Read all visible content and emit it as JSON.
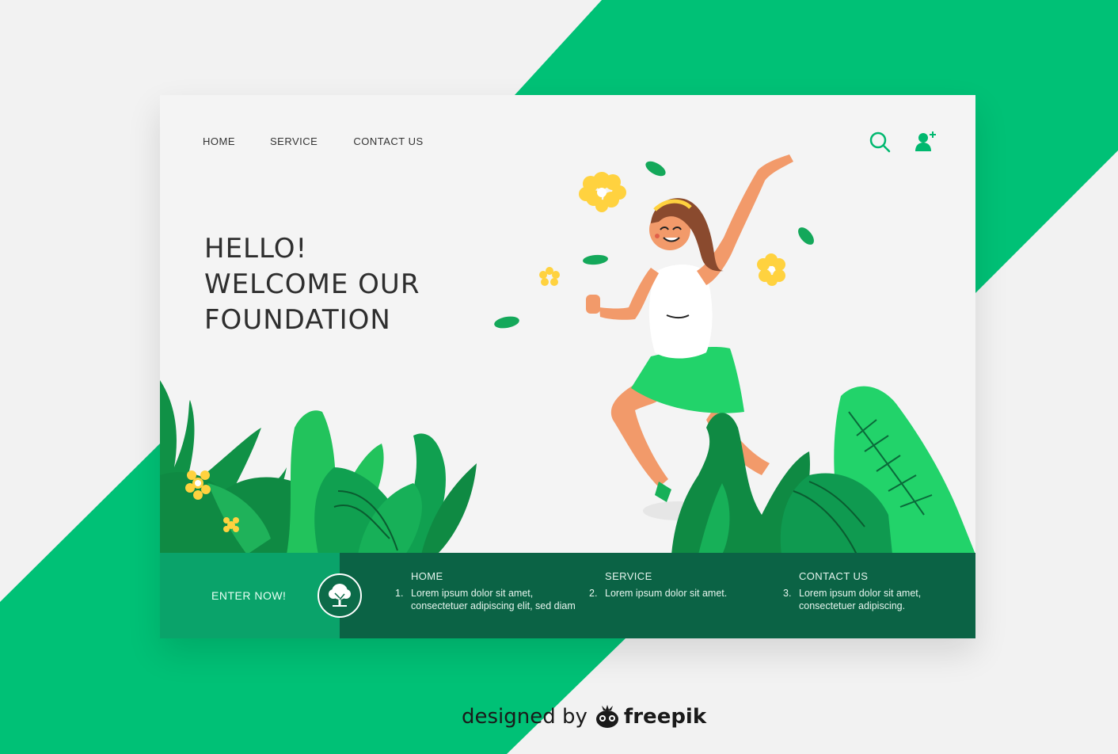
{
  "colors": {
    "accent": "#00c176",
    "dark_green": "#0b6345",
    "mid_green": "#0aa36a",
    "flower": "#ffd23f"
  },
  "nav": {
    "home": "HOME",
    "service": "SERVICE",
    "contact": "CONTACT US"
  },
  "icons": {
    "search": "search-icon",
    "add_user": "add-user-icon"
  },
  "hero": {
    "line1": "HELLO!",
    "line2": "WELCOME OUR",
    "line3": "FOUNDATION"
  },
  "footer": {
    "enter_label": "ENTER NOW!",
    "columns": [
      {
        "title": "HOME",
        "num": "1.",
        "text": "Lorem ipsum dolor sit amet, consectetuer adipiscing elit, sed diam"
      },
      {
        "title": "SERVICE",
        "num": "2.",
        "text": "Lorem ipsum dolor sit amet."
      },
      {
        "title": "CONTACT US",
        "num": "3.",
        "text": "Lorem ipsum dolor sit amet, consectetuer adipiscing."
      }
    ]
  },
  "credit": {
    "designed": "designed by",
    "brand": "freepik"
  }
}
